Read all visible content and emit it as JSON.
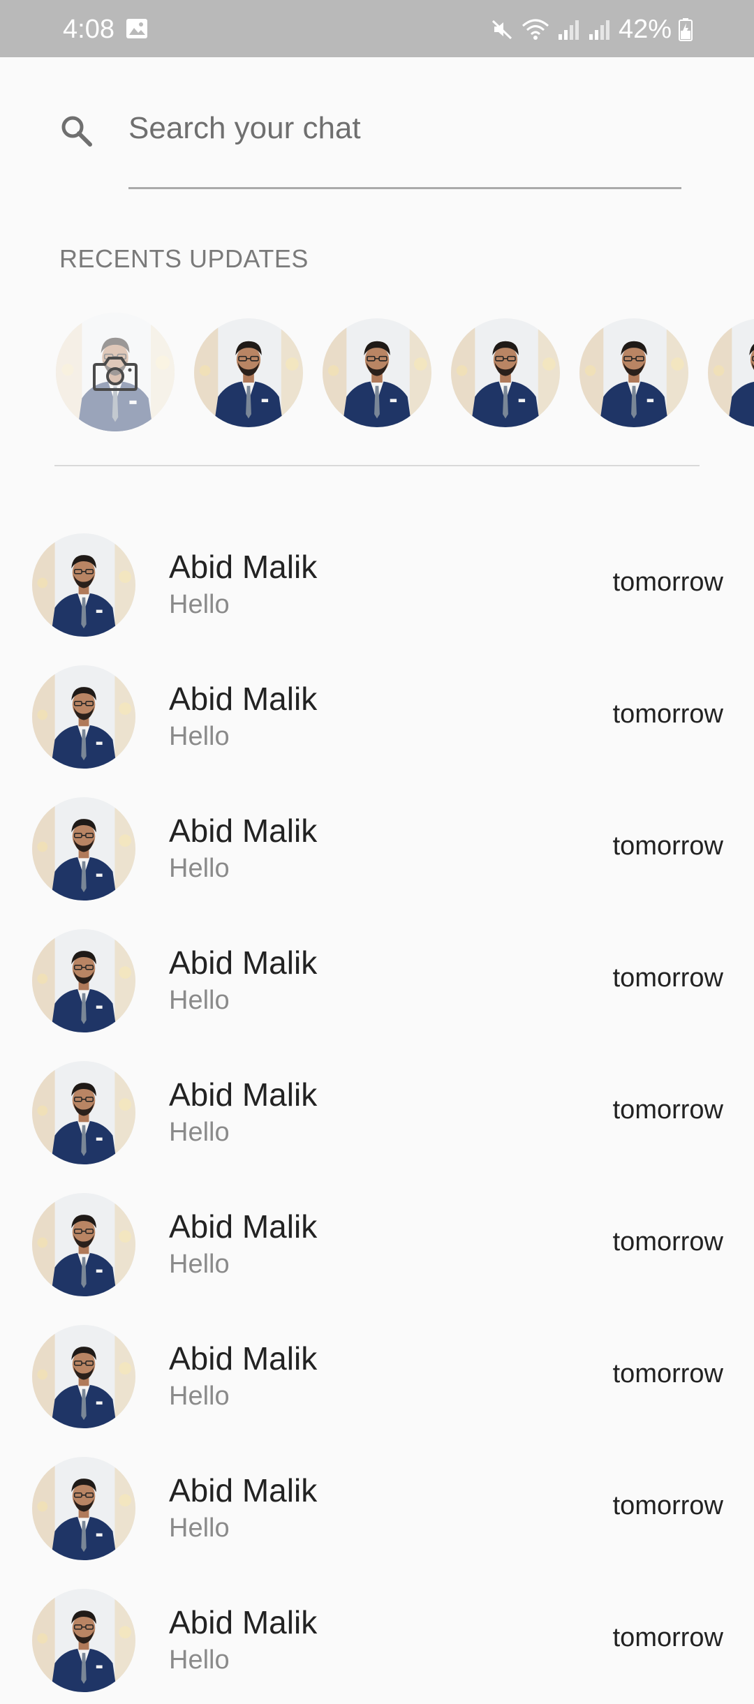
{
  "status_bar": {
    "time": "4:08",
    "battery": "42%",
    "icons": [
      "gallery-icon",
      "mute-icon",
      "wifi-icon",
      "signal-icon",
      "signal-icon",
      "battery-icon"
    ]
  },
  "search": {
    "placeholder": "Search your chat",
    "value": ""
  },
  "recents": {
    "title": "RECENTS UPDATES",
    "story_count_visible": 6
  },
  "chats": [
    {
      "name": "Abid Malik",
      "preview": "Hello",
      "time": "tomorrow"
    },
    {
      "name": "Abid Malik",
      "preview": "Hello",
      "time": "tomorrow"
    },
    {
      "name": "Abid Malik",
      "preview": "Hello",
      "time": "tomorrow"
    },
    {
      "name": "Abid Malik",
      "preview": "Hello",
      "time": "tomorrow"
    },
    {
      "name": "Abid Malik",
      "preview": "Hello",
      "time": "tomorrow"
    },
    {
      "name": "Abid Malik",
      "preview": "Hello",
      "time": "tomorrow"
    },
    {
      "name": "Abid Malik",
      "preview": "Hello",
      "time": "tomorrow"
    },
    {
      "name": "Abid Malik",
      "preview": "Hello",
      "time": "tomorrow"
    },
    {
      "name": "Abid Malik",
      "preview": "Hello",
      "time": "tomorrow"
    }
  ],
  "colors": {
    "status_bar_bg": "#b9b9b9",
    "background": "#fafafa",
    "suit": "#1f3566",
    "muted_text": "#8a8a8a"
  }
}
